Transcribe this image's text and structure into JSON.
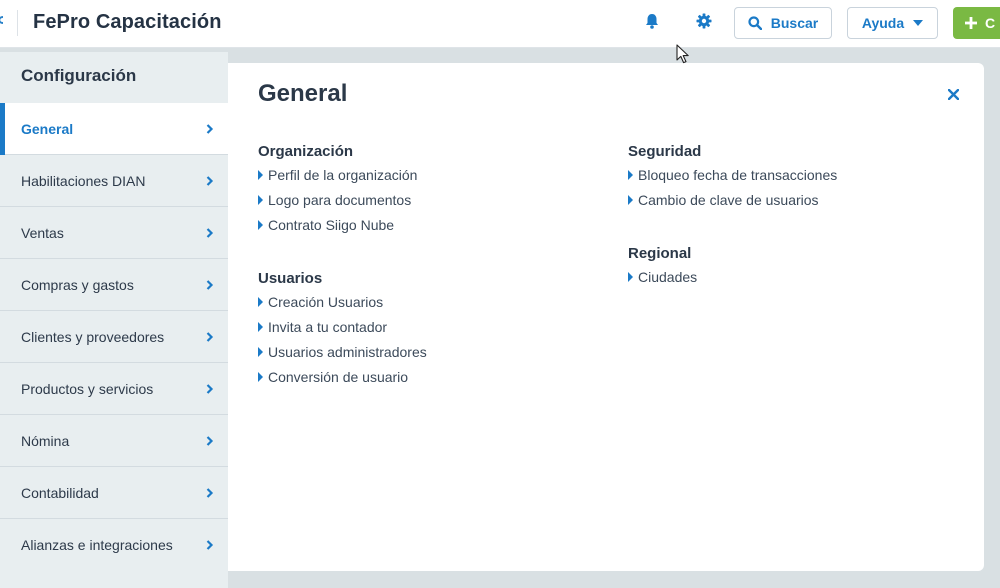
{
  "app": {
    "title": "FePro Capacitación"
  },
  "header": {
    "search_label": "Buscar",
    "help_label": "Ayuda",
    "create_label": "C",
    "icons": {
      "notifications": "bell-icon",
      "settings": "gear-icon",
      "search": "search-icon",
      "help_caret": "caret-down-icon",
      "create": "plus-icon"
    }
  },
  "sidebar": {
    "title": "Configuración",
    "items": [
      {
        "label": "General",
        "active": true
      },
      {
        "label": "Habilitaciones DIAN"
      },
      {
        "label": "Ventas"
      },
      {
        "label": "Compras y gastos"
      },
      {
        "label": "Clientes y proveedores"
      },
      {
        "label": "Productos y servicios"
      },
      {
        "label": "Nómina"
      },
      {
        "label": "Contabilidad"
      },
      {
        "label": "Alianzas e integraciones"
      }
    ]
  },
  "content": {
    "title": "General",
    "sections": [
      {
        "title": "Organización",
        "links": [
          "Perfil de la organización",
          "Logo para documentos",
          "Contrato Siigo Nube"
        ]
      },
      {
        "title": "Usuarios",
        "links": [
          "Creación Usuarios",
          "Invita a tu contador",
          "Usuarios administradores",
          "Conversión de usuario"
        ]
      },
      {
        "title": "Seguridad",
        "links": [
          "Bloqueo fecha de transacciones",
          "Cambio de clave de usuarios"
        ]
      },
      {
        "title": "Regional",
        "links": [
          "Ciudades"
        ]
      }
    ]
  },
  "colors": {
    "accent": "#1b7ac7",
    "create_button": "#7ab943",
    "title_text": "#2b3848"
  }
}
